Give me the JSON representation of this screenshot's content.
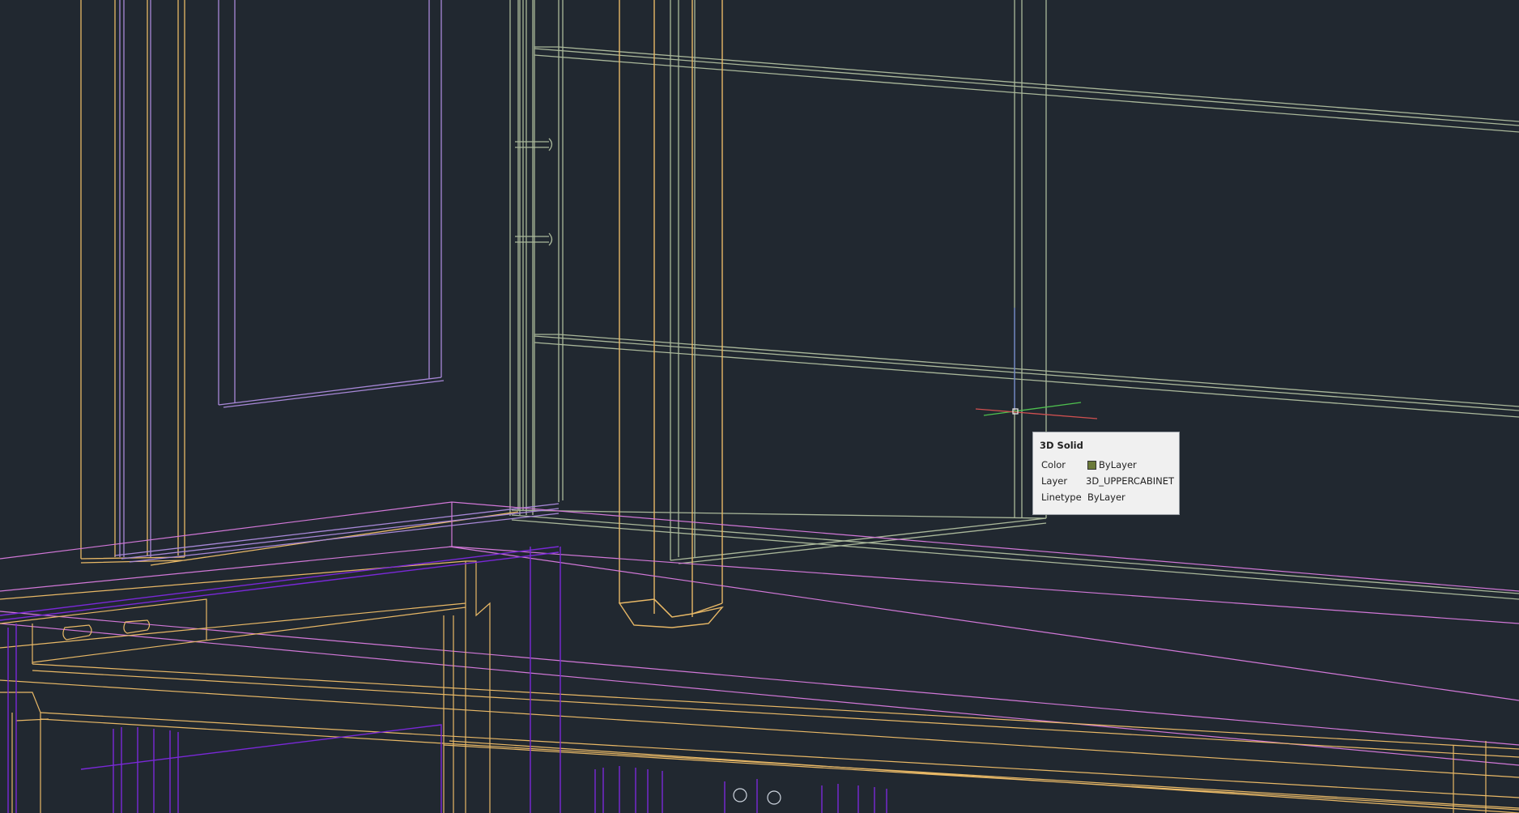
{
  "tooltip": {
    "title": "3D Solid",
    "rows": [
      {
        "key": "Color",
        "value": "ByLayer"
      },
      {
        "key": "Layer",
        "value": "3D_UPPERCABINET"
      },
      {
        "key": "Linetype",
        "value": "ByLayer"
      }
    ],
    "color_swatch": "#6b7a3a"
  },
  "colors": {
    "background": "#212830",
    "cabinet_green": "#aab89a",
    "orange": "#e8b866",
    "lilac": "#a888d8",
    "magenta": "#d278d8",
    "violet": "#7a28d8",
    "crosshair_green": "#4ec04e",
    "crosshair_red": "#d05050"
  },
  "cursor": {
    "icon": "crosshair-cursor-icon"
  }
}
